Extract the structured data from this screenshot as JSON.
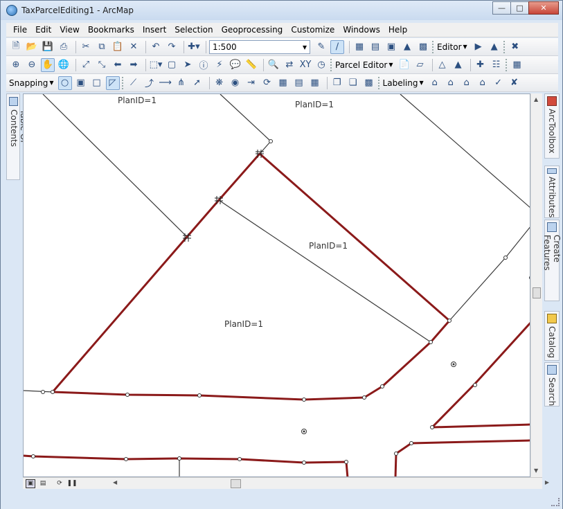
{
  "window": {
    "title": "TaxParcelEditing1 - ArcMap"
  },
  "menu": [
    "File",
    "Edit",
    "View",
    "Bookmarks",
    "Insert",
    "Selection",
    "Geoprocessing",
    "Customize",
    "Windows",
    "Help"
  ],
  "toolbar": {
    "scale": "1:500",
    "editor_label": "Editor",
    "parcel_editor_label": "Parcel Editor",
    "snapping_label": "Snapping",
    "labeling_label": "Labeling"
  },
  "docks": {
    "left": "Table Of Contents",
    "right": [
      "ArcToolbox",
      "Attributes",
      "Create Features",
      "Catalog",
      "Search"
    ]
  },
  "map": {
    "labels": [
      "PlanID=1",
      "PlanID=1",
      "PlanID=1",
      "PlanID=1"
    ]
  }
}
